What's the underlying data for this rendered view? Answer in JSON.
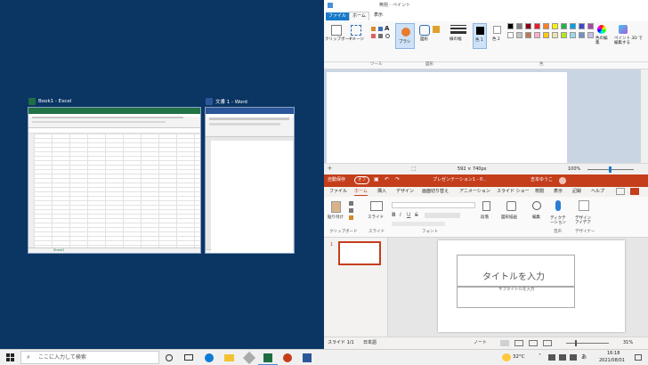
{
  "excel": {
    "title": "Book1 - Excel",
    "sheet_tab": "Sheet1"
  },
  "word": {
    "title": "文書 1 - Word"
  },
  "paint": {
    "title": "無題 - ペイント",
    "tabs": [
      "ファイル",
      "ホーム",
      "表示"
    ],
    "groups": [
      "ツール",
      "図形",
      "色"
    ],
    "labels": {
      "clipboard": "クリップボード",
      "image": "イメージ",
      "brush": "ブラシ",
      "shapes": "図形",
      "size": "線の幅",
      "color1": "色 1",
      "color2": "色 2",
      "edit_colors": "色の編集",
      "paint3d": "ペイント 3D で編集する"
    },
    "status": {
      "dimensions": "592 × 740px",
      "zoom": "100%"
    },
    "palette": [
      "#000000",
      "#7f7f7f",
      "#880015",
      "#ed1c24",
      "#ff7f27",
      "#fff200",
      "#22b14c",
      "#00a2e8",
      "#3f48cc",
      "#a349a4",
      "#ffffff",
      "#c3c3c3",
      "#b97a57",
      "#ffaec9",
      "#ffc90e",
      "#efe4b0",
      "#b5e61d",
      "#99d9ea",
      "#7092be",
      "#c8bfe7"
    ]
  },
  "ppt": {
    "autosave": "自動保存",
    "autosave_state": "オフ",
    "title": "プレゼンテーション1 - P...",
    "user": "吉本ゆうこ",
    "tabs": [
      "ファイル",
      "ホーム",
      "挿入",
      "デザイン",
      "画面切り替え",
      "アニメーション",
      "スライド ショー",
      "校閲",
      "表示",
      "記録",
      "ヘルプ"
    ],
    "groups": {
      "clipboard": "クリップボード",
      "slide": "スライド",
      "font": "フォント",
      "paragraph": "段落",
      "drawing": "図形描画",
      "editing": "編集",
      "voice": "音声",
      "designer": "デザイナー"
    },
    "buttons": {
      "paste": "貼り付け",
      "slide": "スライド",
      "paragraph": "段落",
      "drawing": "図形描画",
      "editing": "編集",
      "dictate": "ディクテーション",
      "designer": "デザイン アイデア"
    },
    "slide_number": "1",
    "placeholder_title": "タイトルを入力",
    "placeholder_subtitle": "サブタイトルを入力",
    "status": {
      "slide": "スライド 1/1",
      "language": "日本語",
      "notes": "ノート",
      "zoom": "31%"
    }
  },
  "taskbar": {
    "search_placeholder": "ここに入力して検索",
    "weather": "32°C",
    "lang": "あ",
    "time": "16:18",
    "date": "2021/08/01"
  }
}
